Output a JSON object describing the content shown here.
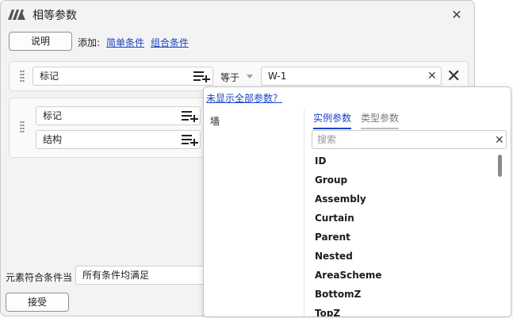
{
  "window": {
    "title": "相等参数",
    "logo_icon": "revit-style-logo",
    "close_icon": "close-icon"
  },
  "toolbar": {
    "explain_label": "说明",
    "add_label": "添加:",
    "simple_condition": "简单条件",
    "combined_condition": "组合条件"
  },
  "condition_row": {
    "param": "标记",
    "operator": "等于",
    "value": "W-1"
  },
  "group": {
    "items": [
      {
        "param": "标记"
      },
      {
        "param": "结构"
      }
    ]
  },
  "bottom": {
    "label": "元素符合条件当",
    "mode": "所有条件均满足",
    "accept_label": "接受"
  },
  "popup": {
    "hint_link": "未显示全部参数？",
    "categories": [
      "墙"
    ],
    "tabs": [
      {
        "label": "实例参数",
        "active": true
      },
      {
        "label": "类型参数",
        "active": false
      }
    ],
    "search_placeholder": "搜索",
    "params": [
      "ID",
      "Group",
      "Assembly",
      "Curtain",
      "Parent",
      "Nested",
      "AreaScheme",
      "BottomZ",
      "TopZ"
    ]
  },
  "colors": {
    "accent": "#1a44c8",
    "window_bg": "#f3f3f3"
  }
}
